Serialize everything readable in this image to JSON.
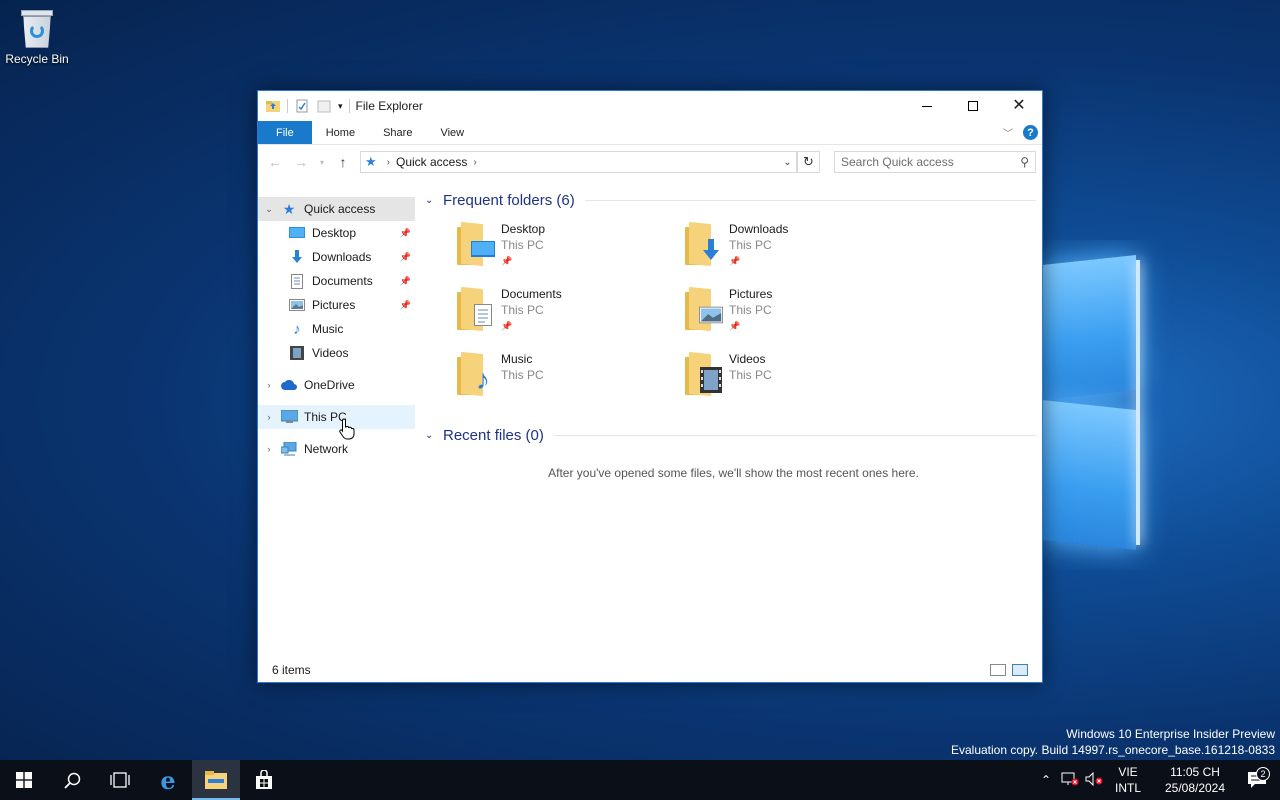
{
  "desktop": {
    "recycle_bin_label": "Recycle Bin"
  },
  "window": {
    "title": "File Explorer",
    "accent": "#1979ca",
    "ribbon_tabs": [
      "File",
      "Home",
      "Share",
      "View"
    ],
    "address": {
      "crumb": "Quick access"
    },
    "search": {
      "placeholder": "Search Quick access"
    },
    "nav": {
      "quick_access": "Quick access",
      "quick_items": [
        {
          "label": "Desktop",
          "icon": "desktop-icon",
          "pinned": true
        },
        {
          "label": "Downloads",
          "icon": "download-icon",
          "pinned": true
        },
        {
          "label": "Documents",
          "icon": "document-icon",
          "pinned": true
        },
        {
          "label": "Pictures",
          "icon": "pictures-icon",
          "pinned": true
        },
        {
          "label": "Music",
          "icon": "music-icon",
          "pinned": false
        },
        {
          "label": "Videos",
          "icon": "videos-icon",
          "pinned": false
        }
      ],
      "onedrive": "OneDrive",
      "this_pc": "This PC",
      "network": "Network"
    },
    "frequent": {
      "title": "Frequent folders (6)",
      "folders": [
        {
          "name": "Desktop",
          "location": "This PC",
          "pinned": true
        },
        {
          "name": "Downloads",
          "location": "This PC",
          "pinned": true
        },
        {
          "name": "Documents",
          "location": "This PC",
          "pinned": true
        },
        {
          "name": "Pictures",
          "location": "This PC",
          "pinned": true
        },
        {
          "name": "Music",
          "location": "This PC",
          "pinned": false
        },
        {
          "name": "Videos",
          "location": "This PC",
          "pinned": false
        }
      ]
    },
    "recent": {
      "title": "Recent files (0)",
      "empty_message": "After you've opened some files, we'll show the most recent ones here."
    },
    "status": {
      "items": "6 items"
    }
  },
  "watermark": {
    "line1": "Windows 10 Enterprise Insider Preview",
    "line2": "Evaluation copy. Build 14997.rs_onecore_base.161218-0833"
  },
  "taskbar": {
    "lang_line1": "VIE",
    "lang_line2": "INTL",
    "time": "11:05 CH",
    "date": "25/08/2024",
    "notifications": "2"
  }
}
